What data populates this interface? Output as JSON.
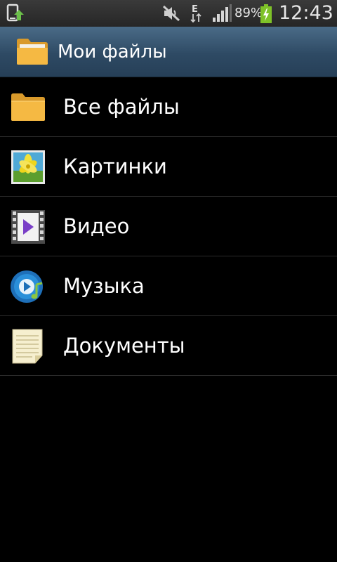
{
  "status_bar": {
    "network_type": "E",
    "battery_percent": "89%",
    "clock": "12:43"
  },
  "action_bar": {
    "title": "Мои файлы",
    "icon": "folder-icon"
  },
  "categories": [
    {
      "label": "Все файлы",
      "icon": "folder-icon"
    },
    {
      "label": "Картинки",
      "icon": "picture-icon"
    },
    {
      "label": "Видео",
      "icon": "video-icon"
    },
    {
      "label": "Музыка",
      "icon": "music-icon"
    },
    {
      "label": "Документы",
      "icon": "document-icon"
    }
  ],
  "colors": {
    "background": "#000000",
    "action_bar": "#2e4a64",
    "folder": "#f5b943",
    "battery_charging": "#7ec228",
    "divider": "#2b2b2b"
  }
}
